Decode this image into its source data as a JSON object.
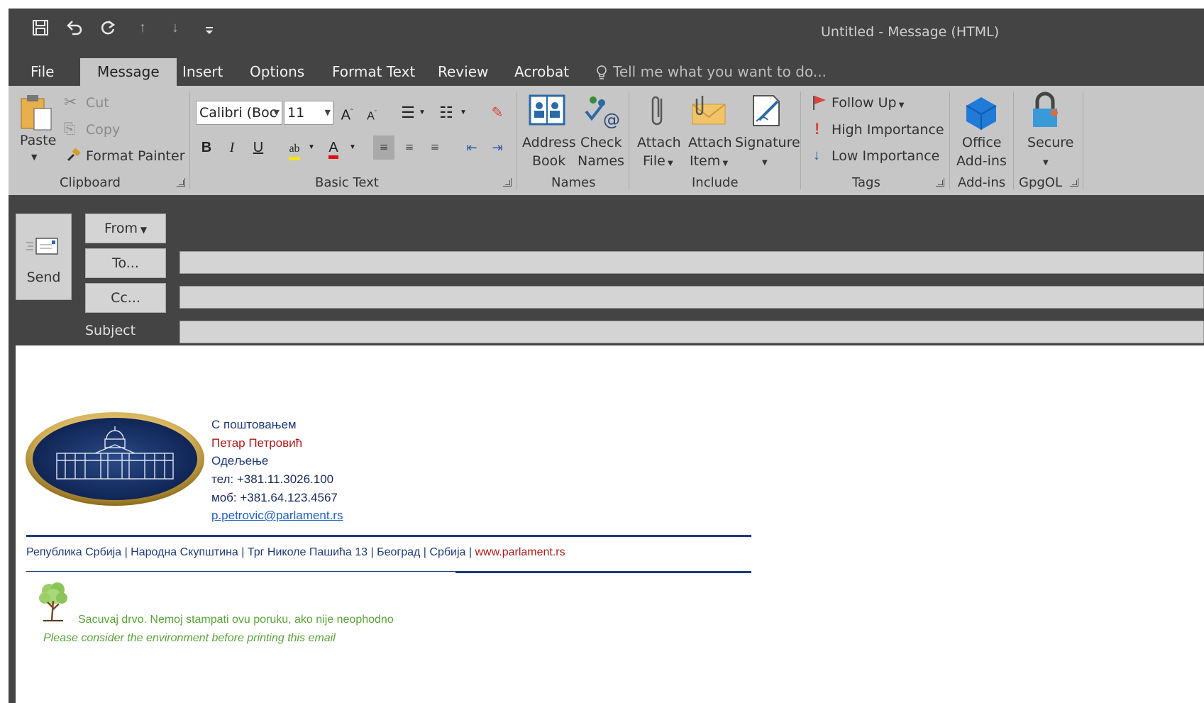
{
  "window": {
    "title": "Untitled - Message (HTML)"
  },
  "quick_access": [
    "save-icon",
    "undo-icon",
    "redo-icon",
    "up-arrow-icon",
    "down-arrow-icon",
    "customize-icon"
  ],
  "tabs": [
    "File",
    "Message",
    "Insert",
    "Options",
    "Format Text",
    "Review",
    "Acrobat"
  ],
  "active_tab": "Message",
  "tell_me": "Tell me what you want to do...",
  "ribbon": {
    "clipboard": {
      "paste": "Paste",
      "cut": "Cut",
      "copy": "Copy",
      "format_painter": "Format Painter",
      "group": "Clipboard"
    },
    "basic_text": {
      "font": "Calibri (Boc",
      "size": "11",
      "bold": "B",
      "italic": "I",
      "underline": "U",
      "group": "Basic Text"
    },
    "names": {
      "address_book_1": "Address",
      "address_book_2": "Book",
      "check_names_1": "Check",
      "check_names_2": "Names",
      "group": "Names"
    },
    "include": {
      "attach_file_1": "Attach",
      "attach_file_2": "File",
      "attach_item_1": "Attach",
      "attach_item_2": "Item",
      "signature": "Signature",
      "group": "Include"
    },
    "tags": {
      "follow_up": "Follow Up",
      "high": "High Importance",
      "low": "Low Importance",
      "group": "Tags"
    },
    "addins": {
      "office_1": "Office",
      "office_2": "Add-ins",
      "group": "Add-ins"
    },
    "gpgol": {
      "secure": "Secure",
      "group": "GpgOL"
    }
  },
  "compose": {
    "send": "Send",
    "from": "From",
    "to": "To...",
    "cc": "Cc...",
    "subject": "Subject",
    "to_value": "",
    "cc_value": "",
    "subject_value": ""
  },
  "signature": {
    "greeting": "С поштовањем",
    "name": "Петар Петровић",
    "department": "Одељење",
    "phone": "тел: +381.11.3026.100",
    "mobile": "моб: +381.64.123.4567",
    "email": "p.petrovic@parlament.rs",
    "address": "Република Србија | Народна Скупштина | Трг Николе Пашића 13 | Београд | Србија |",
    "website": "www.parlament.rs",
    "eco_sr": "Sacuvaj drvo. Nemoj stampati ovu poruku, ako nije neophodno",
    "eco_en": "Please consider the environment before printing this email"
  },
  "colors": {
    "accent_blue": "#1f3a78",
    "accent_red": "#b01a1a",
    "eco_green": "#5aa33a"
  }
}
